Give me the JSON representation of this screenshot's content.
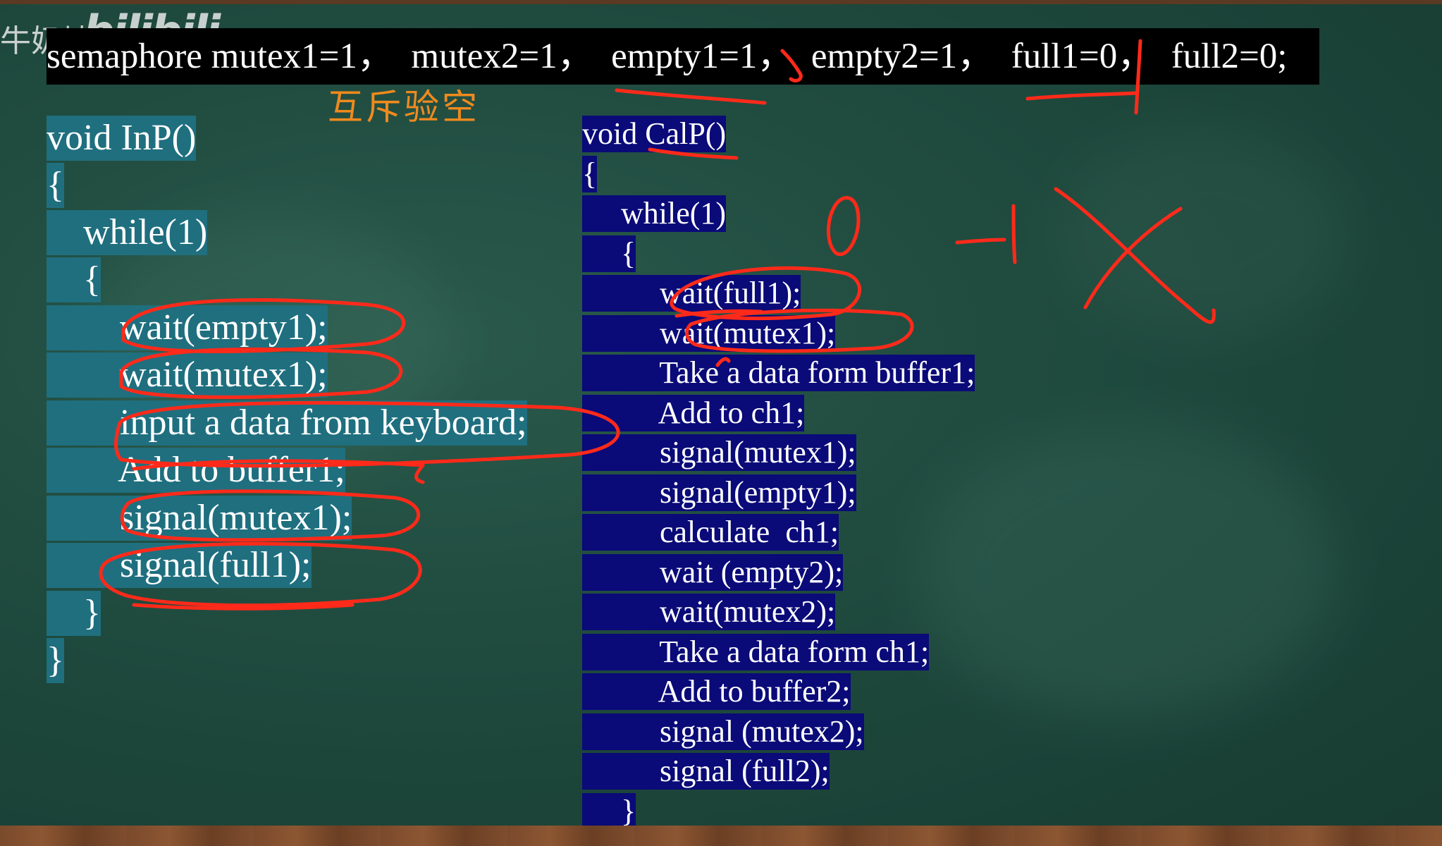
{
  "watermark": {
    "text": "牛奶墙",
    "logo": "bilibili"
  },
  "semaphore_line": "semaphore mutex1=1，  mutex2=1，  empty1=1，  empty2=1，  full1=0，  full2=0;",
  "annotation_cn": "互斥验空",
  "inp": {
    "lines": [
      "void InP()",
      "{",
      "    while(1)",
      "    {",
      "        wait(empty1);",
      "        wait(mutex1);",
      "        input a data from keyboard;",
      "        Add to buffer1;",
      "        signal(mutex1);",
      "        signal(full1);",
      "    }",
      "}"
    ]
  },
  "calp": {
    "lines": [
      "void CalP()",
      "{",
      "     while(1)",
      "     {",
      "          wait(full1);",
      "          wait(mutex1);",
      "          Take a data form buffer1;",
      "          Add to ch1;",
      "          signal(mutex1);",
      "          signal(empty1);",
      "          calculate  ch1;",
      "          wait (empty2);",
      "          wait(mutex2);",
      "          Take a data form ch1;",
      "          Add to buffer2;",
      "          signal (mutex2);",
      "          signal (full2);",
      "     }",
      "}"
    ]
  },
  "handwriting": {
    "zero": "0",
    "minus_one": "-1"
  },
  "colors": {
    "board": "#1f4a3e",
    "inp_highlight": "#1f6f7f",
    "calp_highlight": "#0a0a78",
    "ink": "#ff2a1a",
    "note": "#f08a1e"
  }
}
